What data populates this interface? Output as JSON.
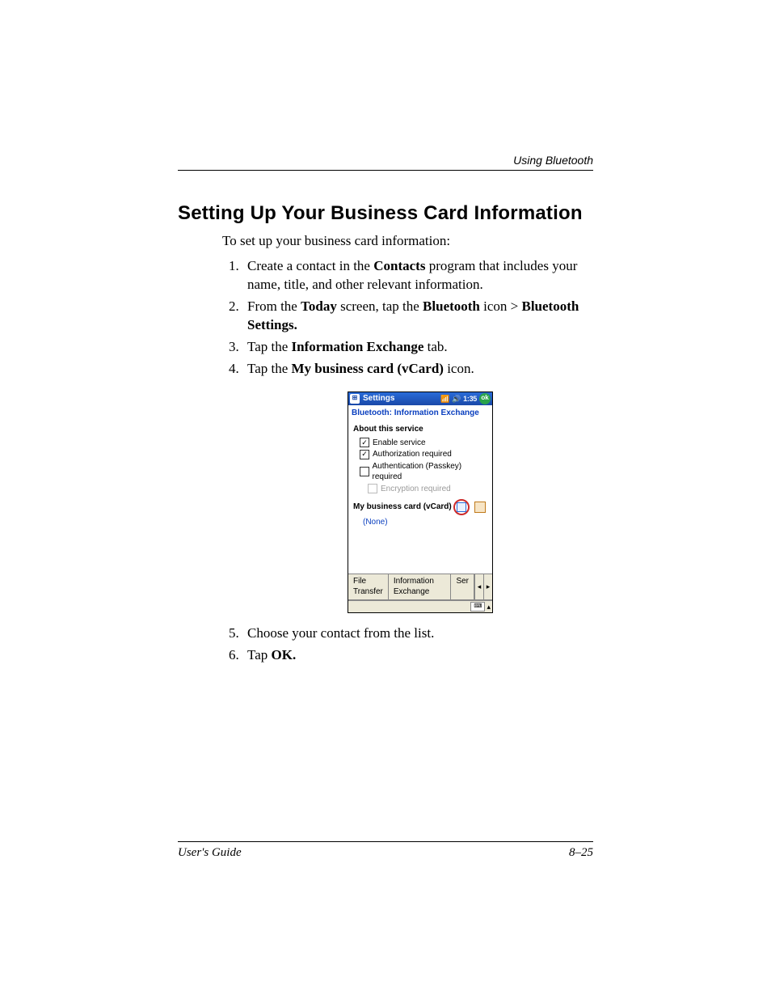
{
  "header": {
    "running": "Using Bluetooth"
  },
  "title": "Setting Up Your Business Card Information",
  "intro": "To set up your business card information:",
  "steps": {
    "s1": {
      "pre": "Create a contact in the ",
      "b1": "Contacts",
      "post": " program that includes your name, title, and other relevant information."
    },
    "s2": {
      "pre": "From the ",
      "b1": "Today",
      "mid1": " screen, tap the ",
      "b2": "Bluetooth",
      "mid2": " icon > ",
      "b3": "Bluetooth Settings."
    },
    "s3": {
      "pre": "Tap the ",
      "b1": "Information Exchange",
      "post": " tab."
    },
    "s4": {
      "pre": "Tap the ",
      "b1": "My business card (vCard)",
      "post": " icon."
    },
    "s5": {
      "text": "Choose your contact from the list."
    },
    "s6": {
      "pre": "Tap ",
      "b1": "OK."
    }
  },
  "device": {
    "titlebar": {
      "app": "Settings",
      "status": "1:35",
      "ok": "ok"
    },
    "subheader": "Bluetooth: Information Exchange",
    "section_title": "About this service",
    "cb": {
      "enable": "Enable service",
      "auth": "Authorization required",
      "passkey": "Authentication (Passkey) required",
      "encrypt": "Encryption required"
    },
    "vcard_label": "My business card (vCard)",
    "none": "(None)",
    "tabs": {
      "t1": "File Transfer",
      "t2": "Information Exchange",
      "t3": "Ser"
    }
  },
  "footer": {
    "left": "User's Guide",
    "right": "8–25"
  }
}
